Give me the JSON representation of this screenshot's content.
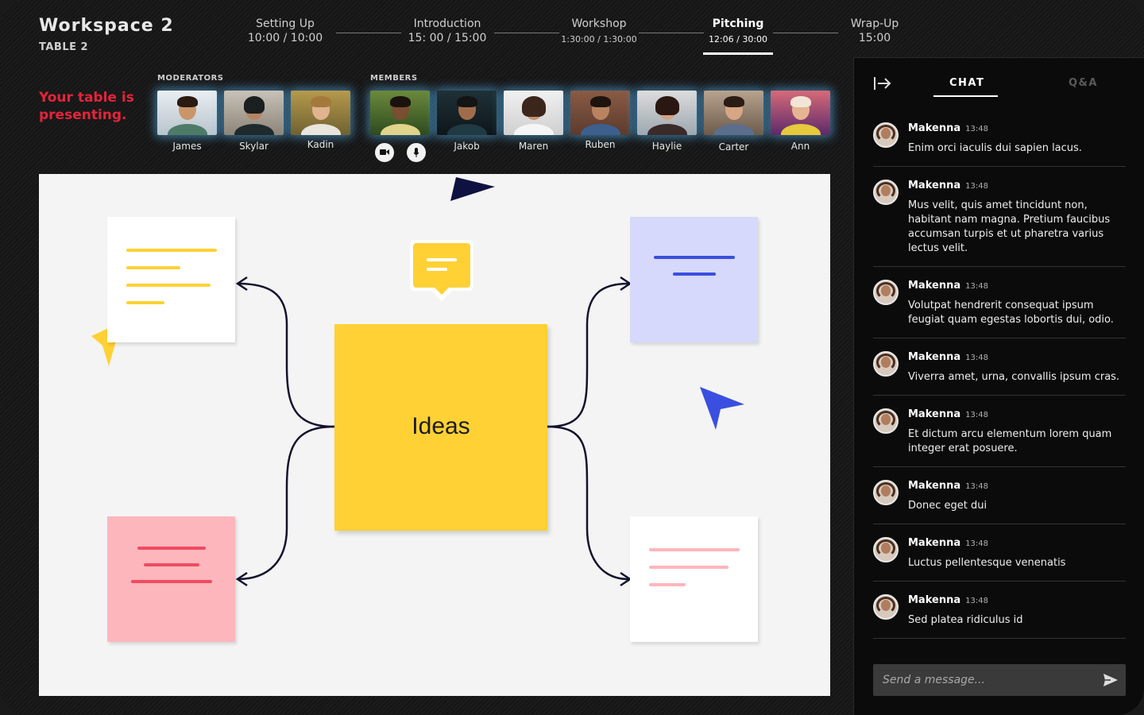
{
  "workspace": {
    "title": "Workspace 2",
    "table": "TABLE 2"
  },
  "stages": [
    {
      "name": "Setting Up",
      "time": "10:00 / 10:00"
    },
    {
      "name": "Introduction",
      "time": "15: 00 / 15:00"
    },
    {
      "name": "Workshop",
      "time": "1:30:00 / 1:30:00"
    },
    {
      "name": "Pitching",
      "time": "12:06 / 30:00"
    },
    {
      "name": "Wrap-Up",
      "time": "15:00"
    }
  ],
  "presenting": "Your table is presenting.",
  "moderators_label": "MODERATORS",
  "members_label": "MEMBERS",
  "moderators": [
    {
      "name": "James"
    },
    {
      "name": "Skylar"
    },
    {
      "name": "Kadin"
    }
  ],
  "members": [
    {
      "name": "Jakob"
    },
    {
      "name": "Maren"
    },
    {
      "name": "Ruben"
    },
    {
      "name": "Haylie"
    },
    {
      "name": "Carter"
    },
    {
      "name": "Ann"
    }
  ],
  "canvas": {
    "central_note": "Ideas"
  },
  "chat": {
    "tabs": [
      "CHAT",
      "Q&A"
    ],
    "messages": [
      {
        "author": "Makenna",
        "time": "13:48",
        "text": "Enim orci iaculis dui sapien lacus."
      },
      {
        "author": "Makenna",
        "time": "13:48",
        "text": "Mus velit, quis amet tincidunt non, habitant nam magna. Pretium faucibus accumsan turpis et ut pharetra varius lectus velit."
      },
      {
        "author": "Makenna",
        "time": "13:48",
        "text": "Volutpat hendrerit consequat ipsum feugiat quam egestas lobortis dui, odio."
      },
      {
        "author": "Makenna",
        "time": "13:48",
        "text": "Viverra amet, urna, convallis ipsum cras."
      },
      {
        "author": "Makenna",
        "time": "13:48",
        "text": "Et dictum arcu elementum lorem quam integer erat posuere."
      },
      {
        "author": "Makenna",
        "time": "13:48",
        "text": "Donec eget dui"
      },
      {
        "author": "Makenna",
        "time": "13:48",
        "text": "Luctus pellentesque venenatis"
      },
      {
        "author": "Makenna",
        "time": "13:48",
        "text": "Sed platea ridiculus id"
      }
    ],
    "placeholder": "Send a message..."
  },
  "colors": {
    "accent_red": "#e3243b",
    "tile_glow": "#5abeff",
    "note_yellow": "#ffd135",
    "note_purple": "#d6d9fb",
    "note_pink": "#fdb6bc",
    "cursor_blue": "#3a4fe0",
    "cursor_navy": "#0f1240"
  },
  "icons": [
    "exit-icon",
    "camera-icon",
    "mic-icon",
    "send-icon",
    "comment-icon",
    "cursor-icon"
  ]
}
